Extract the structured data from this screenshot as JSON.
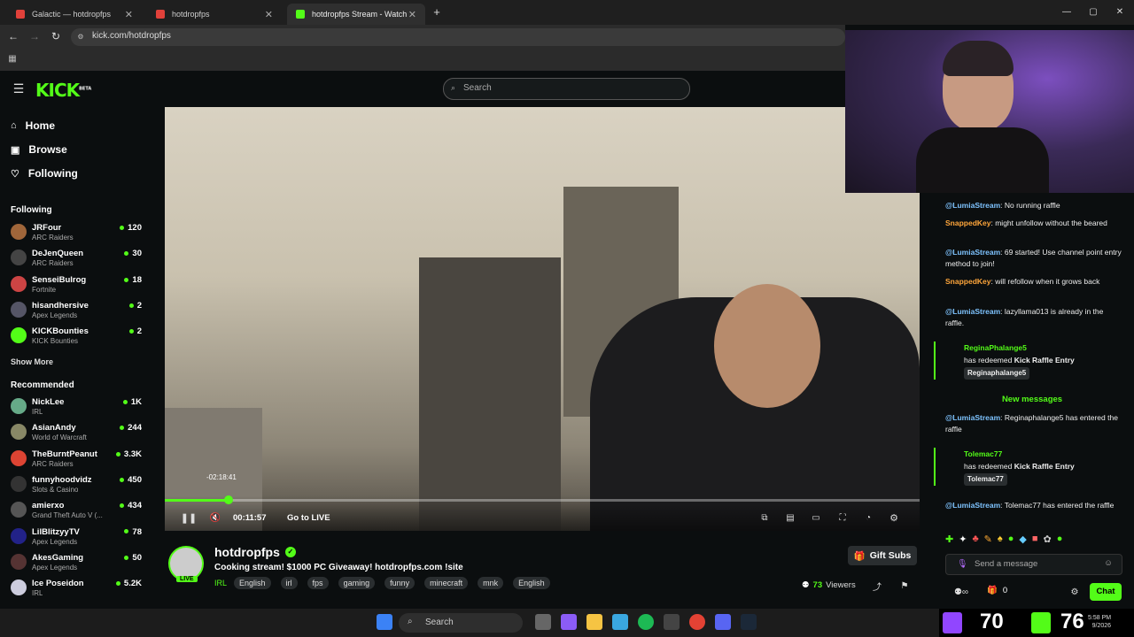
{
  "browser": {
    "tabs": [
      {
        "title": "Galactic — hotdropfps",
        "favcolor": "#e0413a"
      },
      {
        "title": "hotdropfps",
        "favcolor": "#e0413a"
      },
      {
        "title": "hotdropfps Stream - Watch Live",
        "favcolor": "#53fc18"
      }
    ],
    "url": "kick.com/hotdropfps"
  },
  "header": {
    "logo": "KICK",
    "logo_badge": "BETA",
    "search_placeholder": "Search"
  },
  "nav": [
    {
      "label": "Home",
      "icon": "home-icon"
    },
    {
      "label": "Browse",
      "icon": "compass-icon"
    },
    {
      "label": "Following",
      "icon": "heart-icon"
    }
  ],
  "following": {
    "title": "Following",
    "channels": [
      {
        "name": "JRFour",
        "category": "ARC Raiders",
        "viewers": "120",
        "color": "#a0663a"
      },
      {
        "name": "DeJenQueen",
        "category": "ARC Raiders",
        "viewers": "30",
        "color": "#444"
      },
      {
        "name": "SenseiBulrog",
        "category": "Fortnite",
        "viewers": "18",
        "color": "#c44"
      },
      {
        "name": "hisandhersive",
        "category": "Apex Legends",
        "viewers": "2",
        "color": "#556"
      },
      {
        "name": "KICKBounties",
        "category": "KICK Bounties",
        "viewers": "2",
        "color": "#53fc18"
      }
    ],
    "show_more": "Show More"
  },
  "recommended": {
    "title": "Recommended",
    "channels": [
      {
        "name": "NickLee",
        "category": "IRL",
        "viewers": "1K",
        "color": "#6a8"
      },
      {
        "name": "AsianAndy",
        "category": "World of Warcraft",
        "viewers": "244",
        "color": "#886"
      },
      {
        "name": "TheBurntPeanut",
        "category": "ARC Raiders",
        "viewers": "3.3K",
        "color": "#d43"
      },
      {
        "name": "funnyhoodvidz",
        "category": "Slots & Casino",
        "viewers": "450",
        "color": "#333"
      },
      {
        "name": "amierxo",
        "category": "Grand Theft Auto V (...",
        "viewers": "434",
        "color": "#555"
      },
      {
        "name": "LilBlitzyyTV",
        "category": "Apex Legends",
        "viewers": "78",
        "color": "#228"
      },
      {
        "name": "AkesGaming",
        "category": "Apex Legends",
        "viewers": "50",
        "color": "#533"
      },
      {
        "name": "Ice Poseidon",
        "category": "IRL",
        "viewers": "5.2K",
        "color": "#ccd"
      }
    ]
  },
  "player": {
    "hover_time": "-02:18:41",
    "elapsed": "00:11:57",
    "go_live": "Go to LIVE",
    "progress_fraction": 0.085
  },
  "stream": {
    "channel": "hotdropfps",
    "live_badge": "LIVE",
    "title": "Cooking stream! $1000 PC Giveaway! hotdropfps.com !site",
    "category": "IRL",
    "tags": [
      "English",
      "irl",
      "fps",
      "gaming",
      "funny",
      "minecraft",
      "mnk",
      "English"
    ],
    "viewers": "73",
    "viewers_label": "Viewers",
    "gift_subs": "Gift Subs"
  },
  "chat": {
    "messages": [
      {
        "user": "@LumiaStream",
        "text": ": No running raffle",
        "style": "user"
      },
      {
        "user": "SnappedKey",
        "text": ": might unfollow without the beared",
        "style": "user2"
      },
      {
        "user": "@LumiaStream",
        "text": ": 69 started! Use channel point entry method to join!",
        "style": "user"
      },
      {
        "user": "SnappedKey",
        "text": ": will refollow when it grows back",
        "style": "user2"
      },
      {
        "user": "@LumiaStream",
        "text": ": lazyllama013 is already in the raffle.",
        "style": "user"
      }
    ],
    "redeem1": {
      "user": "ReginaPhalange5",
      "action": "has redeemed",
      "reward": "Kick Raffle Entry",
      "chip": "Reginaphalange5"
    },
    "new_messages": "New messages",
    "msg_after1": {
      "user": "@LumiaStream",
      "text": ": Reginaphalange5 has entered the raffle"
    },
    "redeem2": {
      "user": "Tolemac77",
      "action": "has redeemed",
      "reward": "Kick Raffle Entry",
      "chip": "Tolemac77"
    },
    "msg_after2": {
      "user": "@LumiaStream",
      "text": ": Tolemac77 has entered the raffle"
    },
    "input_placeholder": "Send a message",
    "points": "0",
    "chat_button": "Chat"
  },
  "overlay": {
    "left_number": "70",
    "right_number": "76"
  },
  "taskbar": {
    "search": "Search",
    "time": "5:58 PM",
    "date": "9/2026"
  }
}
